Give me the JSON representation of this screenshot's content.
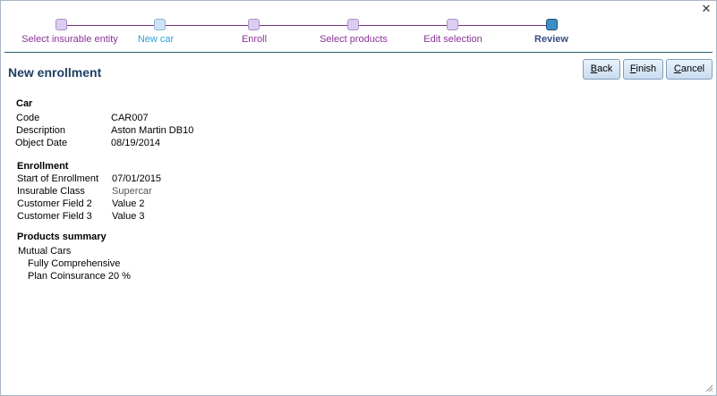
{
  "window": {
    "close_glyph": "✕"
  },
  "wizard": {
    "steps": [
      {
        "label": "Select insurable entity"
      },
      {
        "label": "New car"
      },
      {
        "label": "Enroll"
      },
      {
        "label": "Select products"
      },
      {
        "label": "Edit selection"
      },
      {
        "label": "Review"
      }
    ],
    "colors": {
      "line": "#7a2f86",
      "done": "#dccdf0",
      "current": "#cfe2f3",
      "review": "#3c8ec6"
    }
  },
  "header": {
    "title": "New enrollment",
    "buttons": {
      "back": {
        "accel": "B",
        "rest": "ack"
      },
      "finish": {
        "accel": "F",
        "rest": "inish"
      },
      "cancel": {
        "accel": "C",
        "rest": "ancel"
      }
    }
  },
  "car": {
    "heading": "Car",
    "fields": [
      {
        "label": "Code",
        "value": "CAR007"
      },
      {
        "label": "Description",
        "value": "Aston Martin DB10"
      },
      {
        "label": "Object Date",
        "value": "08/19/2014"
      }
    ]
  },
  "enrollment": {
    "heading": "Enrollment",
    "fields": [
      {
        "label": "Start of Enrollment",
        "value": "07/01/2015"
      },
      {
        "label": "Insurable Class",
        "value": "Supercar"
      },
      {
        "label": "Customer Field 2",
        "value": "Value 2"
      },
      {
        "label": "Customer Field 3",
        "value": "Value 3"
      }
    ]
  },
  "products": {
    "heading": "Products summary",
    "provider": "Mutual Cars",
    "items": [
      {
        "text": "Fully Comprehensive"
      },
      {
        "text": "Plan Coinsurance 20 %"
      }
    ]
  }
}
